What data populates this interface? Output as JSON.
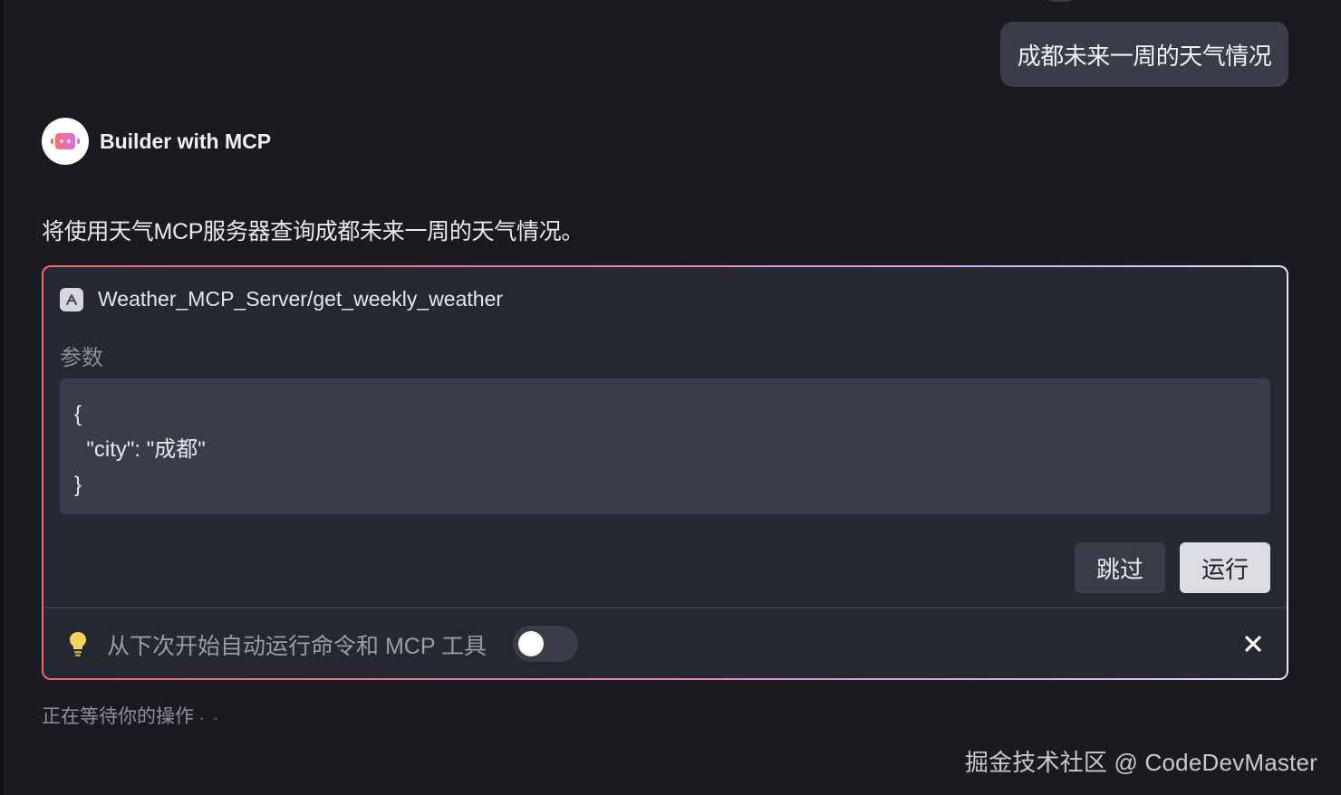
{
  "user_message": "成都未来一周的天气情况",
  "assistant": {
    "name": "Builder with MCP",
    "intro": "将使用天气MCP服务器查询成都未来一周的天气情况。"
  },
  "tool_call": {
    "name": "Weather_MCP_Server/get_weekly_weather",
    "params_label": "参数",
    "code_lines": [
      "{",
      "  \"city\": \"成都\"",
      "}"
    ],
    "skip_label": "跳过",
    "run_label": "运行",
    "auto_run_text": "从下次开始自动运行命令和 MCP 工具",
    "auto_run_enabled": false
  },
  "status": {
    "waiting_text": "正在等待你的操作",
    "dots": "· ·"
  },
  "watermark": "掘金技术社区 @ CodeDevMaster",
  "icons": {
    "avatar": "robot-icon",
    "tool": "tool-icon",
    "tip": "lightbulb-icon",
    "close": "close-icon"
  },
  "colors": {
    "background": "#1a1b20",
    "card": "#262831",
    "bulb": "#f1d35a",
    "border_gradient": [
      "#f0686a",
      "#ef7aa8",
      "#d6a6ee",
      "#e6e2f6"
    ]
  }
}
